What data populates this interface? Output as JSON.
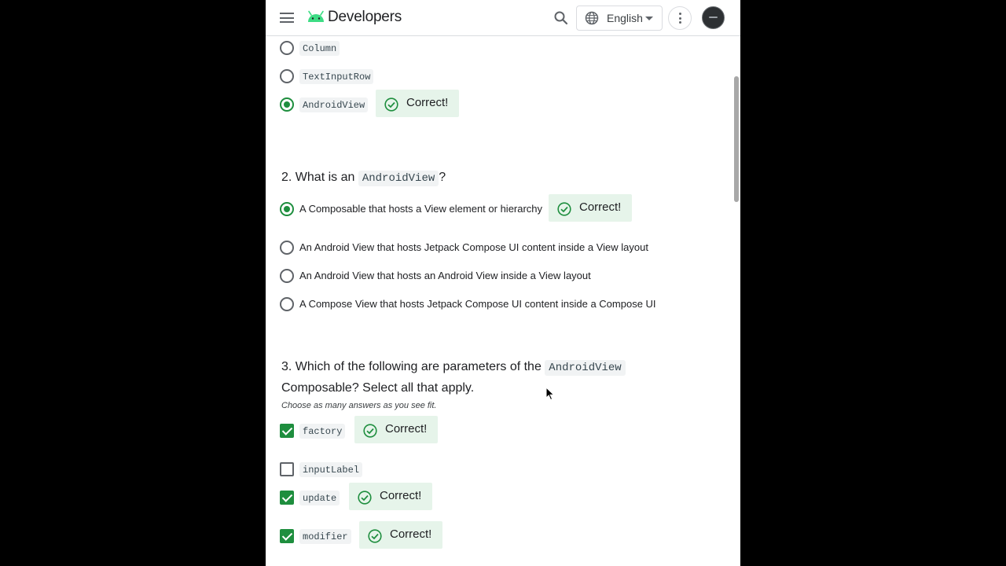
{
  "header": {
    "brand": "Developers",
    "language": "English"
  },
  "question1": {
    "options": [
      {
        "label": "Column",
        "checked": false
      },
      {
        "label": "TextInputRow",
        "checked": false
      },
      {
        "label": "AndroidView",
        "checked": true
      }
    ],
    "feedback": "Correct!"
  },
  "question2": {
    "number": "2.",
    "text_before": "What is an",
    "code": "AndroidView",
    "text_after": "?",
    "options": [
      {
        "label": "A Composable that hosts a View element or hierarchy",
        "checked": true
      },
      {
        "label": "An Android View that hosts Jetpack Compose UI content inside a View layout",
        "checked": false
      },
      {
        "label": "An Android View that hosts an Android View inside a View layout",
        "checked": false
      },
      {
        "label": "A Compose View that hosts Jetpack Compose UI content inside a Compose UI",
        "checked": false
      }
    ],
    "feedback": "Correct!"
  },
  "question3": {
    "number": "3.",
    "text_before": "Which of the following are parameters of the",
    "code": "AndroidView",
    "text_line2": "Composable? Select all that apply.",
    "hint": "Choose as many answers as you see fit.",
    "options": [
      {
        "label": "factory",
        "checked": true,
        "feedback": "Correct!"
      },
      {
        "label": "inputLabel",
        "checked": false,
        "feedback": ""
      },
      {
        "label": "update",
        "checked": true,
        "feedback": "Correct!"
      },
      {
        "label": "modifier",
        "checked": true,
        "feedback": "Correct!"
      }
    ]
  },
  "colors": {
    "accent": "#1e8e3e",
    "correct_bg": "#e6f4ea",
    "android_green": "#3ddc84"
  }
}
